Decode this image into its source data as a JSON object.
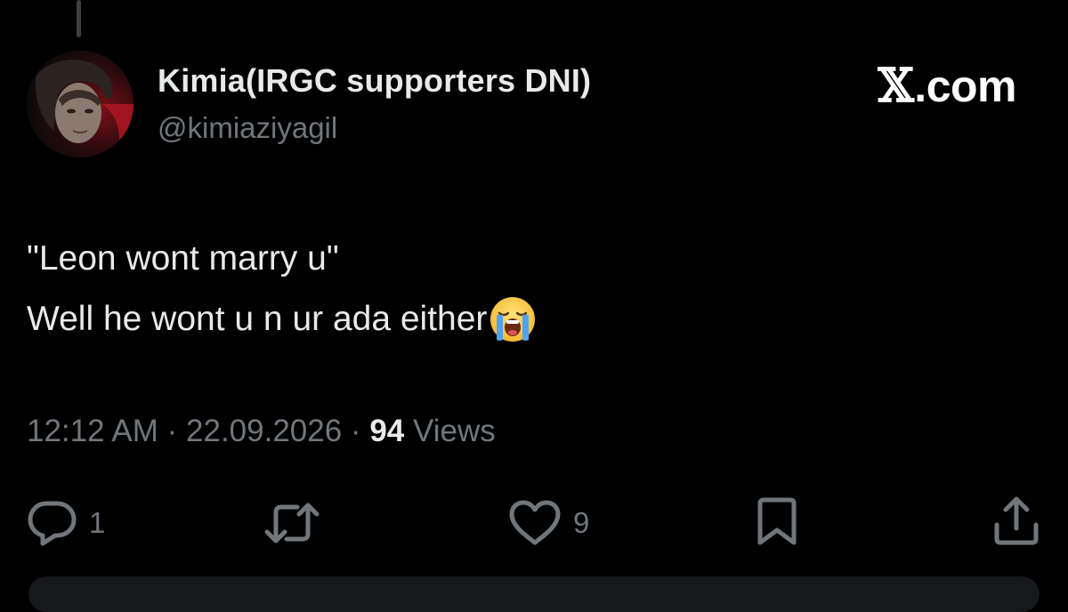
{
  "author": {
    "display_name": "Kimia(IRGC supporters DNI)",
    "handle": "@kimiaziyagil"
  },
  "brand": {
    "mark": "𝕏",
    "suffix": ".com"
  },
  "tweet": {
    "line1": "\"Leon wont marry u\"",
    "line2": "Well he wont u n ur ada either",
    "emoji": "loudly-crying-face"
  },
  "meta": {
    "time": "12:12 AM",
    "separator": "·",
    "date": "22.09.2026",
    "views_count": "94",
    "views_label": "Views"
  },
  "actions": {
    "reply_count": "1",
    "like_count": "9"
  },
  "colors": {
    "background": "#000000",
    "primary_text": "#e7e9ea",
    "secondary_text": "#71767b"
  }
}
